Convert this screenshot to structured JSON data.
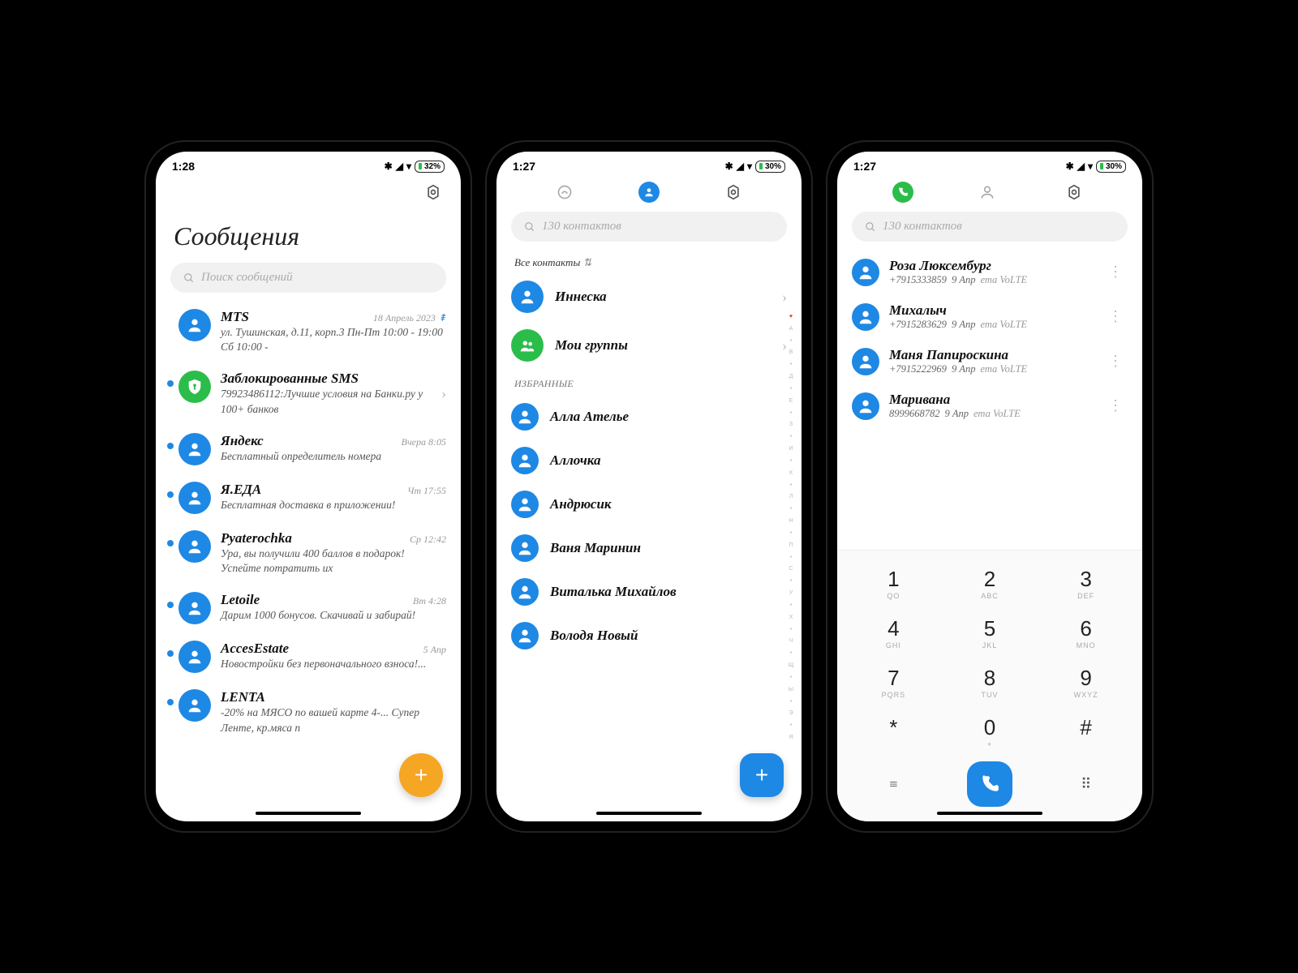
{
  "phone1": {
    "time": "1:28",
    "battery": "32%",
    "title": "Сообщения",
    "search_placeholder": "Поиск сообщений",
    "messages": [
      {
        "sender": "MTS",
        "time": "18 Апрель 2023",
        "preview": "ул. Тушинская, д.11, корп.3 Пн-Пт 10:00 - 19:00 Сб 10:00 -",
        "unread": false,
        "special_icon": true
      },
      {
        "sender": "Заблокированные SMS",
        "time": "",
        "preview": "79923486112:Лучшие условия на Банки.ру у 100+ банков",
        "unread": true,
        "shield": true,
        "chevron": true
      },
      {
        "sender": "Яндекс",
        "time": "Вчера 8:05",
        "preview": "Бесплатный определитель номера",
        "unread": true
      },
      {
        "sender": "Я.ЕДА",
        "time": "Чт 17:55",
        "preview": "Бесплатная доставка в приложении!",
        "unread": true
      },
      {
        "sender": "Pyaterochka",
        "time": "Ср 12:42",
        "preview": "Ура, вы получили 400 баллов в подарок! Успейте потратить их",
        "unread": true
      },
      {
        "sender": "Letoile",
        "time": "Вт 4:28",
        "preview": "Дарим 1000 бонусов. Скачивай и забирай!",
        "unread": true
      },
      {
        "sender": "AccesEstate",
        "time": "5 Апр",
        "preview": "Новостройки без первоначального взноса!...",
        "unread": true
      },
      {
        "sender": "LENTA",
        "time": "",
        "preview": "-20% на МЯСО по вашей карте 4-... Супер Ленте, кр.мяса п",
        "unread": true
      }
    ]
  },
  "phone2": {
    "time": "1:27",
    "battery": "30%",
    "search_placeholder": "130 контактов",
    "dropdown": "Все контакты",
    "top_items": [
      {
        "name": "Иннеска",
        "chevron": true,
        "avatar": "blue"
      },
      {
        "name": "Мои группы",
        "chevron": true,
        "avatar": "green"
      }
    ],
    "favorites_label": "ИЗБРАННЫЕ",
    "favorites": [
      "Алла Ателье",
      "Аллочка",
      "Андрюсик",
      "Ваня Маринин",
      "Виталька Михайлов",
      "Володя Новый"
    ],
    "index": [
      "♥",
      "А",
      "•",
      "В",
      "•",
      "Д",
      "•",
      "Е",
      "•",
      "З",
      "•",
      "И",
      "•",
      "К",
      "•",
      "Л",
      "•",
      "Н",
      "•",
      "П",
      "•",
      "С",
      "•",
      "У",
      "•",
      "Х",
      "•",
      "Ч",
      "•",
      "Щ",
      "•",
      "Ы",
      "•",
      "Э",
      "•",
      "Я"
    ]
  },
  "phone3": {
    "time": "1:27",
    "battery": "30%",
    "search_placeholder": "130 контактов",
    "calls": [
      {
        "name": "Роза Люксембург",
        "number": "+7915333859",
        "date": "9 Апр",
        "sim": "ета VoLTE"
      },
      {
        "name": "Михалыч",
        "number": "+7915283629",
        "date": "9 Апр",
        "sim": "ета VoLTE"
      },
      {
        "name": "Маня Папироскина",
        "number": "+7915222969",
        "date": "9 Апр",
        "sim": "ета VoLTE"
      },
      {
        "name": "Маривана",
        "number": "8999668782",
        "date": "9 Апр",
        "sim": "ета VoLTE"
      }
    ],
    "dialpad": [
      {
        "n": "1",
        "s": "QO"
      },
      {
        "n": "2",
        "s": "ABC"
      },
      {
        "n": "3",
        "s": "DEF"
      },
      {
        "n": "4",
        "s": "GHI"
      },
      {
        "n": "5",
        "s": "JKL"
      },
      {
        "n": "6",
        "s": "MNO"
      },
      {
        "n": "7",
        "s": "PQRS"
      },
      {
        "n": "8",
        "s": "TUV"
      },
      {
        "n": "9",
        "s": "WXYZ"
      },
      {
        "n": "*",
        "s": ""
      },
      {
        "n": "0",
        "s": "+"
      },
      {
        "n": "#",
        "s": ""
      }
    ]
  }
}
